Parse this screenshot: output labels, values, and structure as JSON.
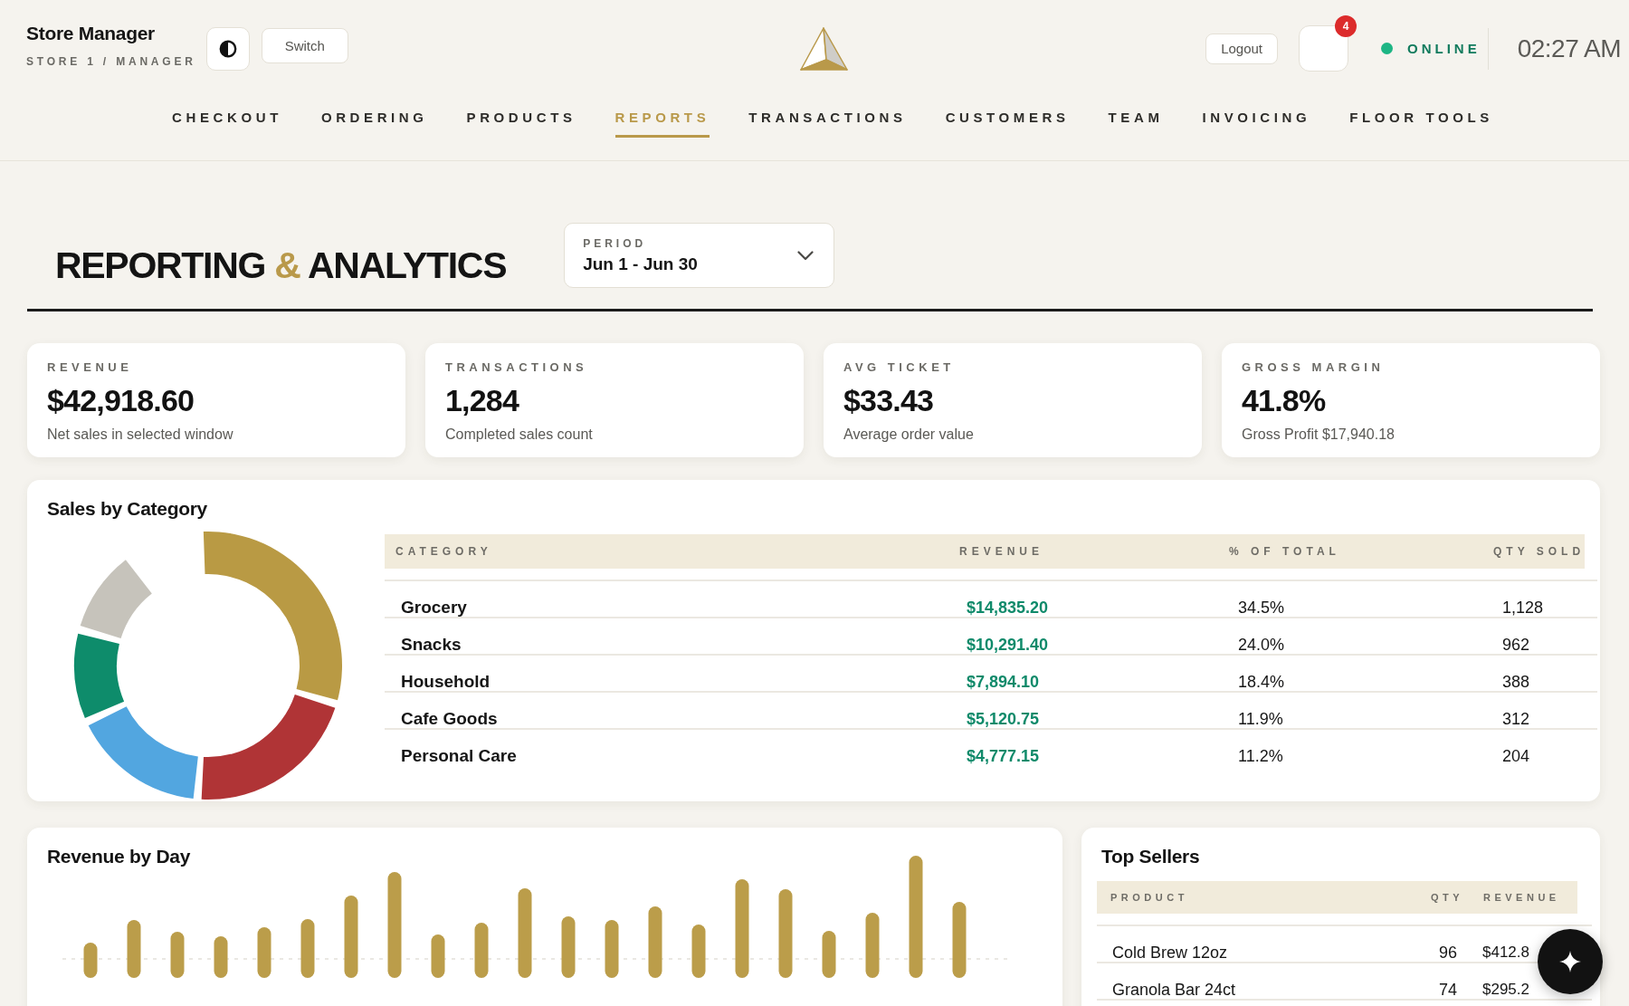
{
  "header": {
    "brand": {
      "title": "Store Manager",
      "subtitle": "STORE 1 / MANAGER"
    },
    "switch_button": "Switch",
    "logout_button": "Logout",
    "notifications": {
      "count": "4"
    },
    "status": {
      "label": "ONLINE",
      "online": true
    },
    "time": "02:27 AM"
  },
  "tabs": [
    {
      "label": "CHECKOUT",
      "selected": false
    },
    {
      "label": "ORDERING",
      "selected": false
    },
    {
      "label": "PRODUCTS",
      "selected": false
    },
    {
      "label": "REPORTS",
      "selected": true
    },
    {
      "label": "TRANSACTIONS",
      "selected": false
    },
    {
      "label": "CUSTOMERS",
      "selected": false
    },
    {
      "label": "TEAM",
      "selected": false
    },
    {
      "label": "INVOICING",
      "selected": false
    },
    {
      "label": "FLOOR TOOLS",
      "selected": false
    }
  ],
  "page_title": [
    {
      "text": "REPORTING",
      "accent": false
    },
    {
      "text": "&",
      "accent": true
    },
    {
      "text": "ANALYTICS",
      "accent": false
    }
  ],
  "period": {
    "label": "PERIOD",
    "value": "Jun 1 - Jun 30"
  },
  "kpis": [
    {
      "label": "REVENUE",
      "value": "$42,918.60",
      "caption": "Net sales in selected window"
    },
    {
      "label": "TRANSACTIONS",
      "value": "1,284",
      "caption": "Completed sales count"
    },
    {
      "label": "AVG TICKET",
      "value": "$33.43",
      "caption": "Average order value"
    },
    {
      "label": "GROSS MARGIN",
      "value": "41.8%",
      "caption": "Gross Profit $17,940.18"
    }
  ],
  "sales_by_category": {
    "title": "Sales by Category",
    "table": {
      "columns": [
        "CATEGORY",
        "REVENUE",
        "% OF TOTAL",
        "QTY SOLD"
      ],
      "rows": [
        [
          "Grocery",
          "$14,835.20",
          "34.5%",
          "1,128"
        ],
        [
          "Snacks",
          "$10,291.40",
          "24.0%",
          "962"
        ],
        [
          "Household",
          "$7,894.10",
          "18.4%",
          "388"
        ],
        [
          "Cafe Goods",
          "$5,120.75",
          "11.9%",
          "312"
        ],
        [
          "Personal Care",
          "$4,777.15",
          "11.2%",
          "204"
        ]
      ]
    }
  },
  "revenue_by_day": {
    "title": "Revenue by Day"
  },
  "top_sellers": {
    "title": "Top Sellers",
    "columns": [
      "PRODUCT",
      "QTY",
      "REVENUE"
    ],
    "rows": [
      [
        "Cold Brew 12oz",
        "96",
        "$412.8"
      ],
      [
        "Granola Bar 24ct",
        "74",
        "$295.2"
      ]
    ]
  }
}
